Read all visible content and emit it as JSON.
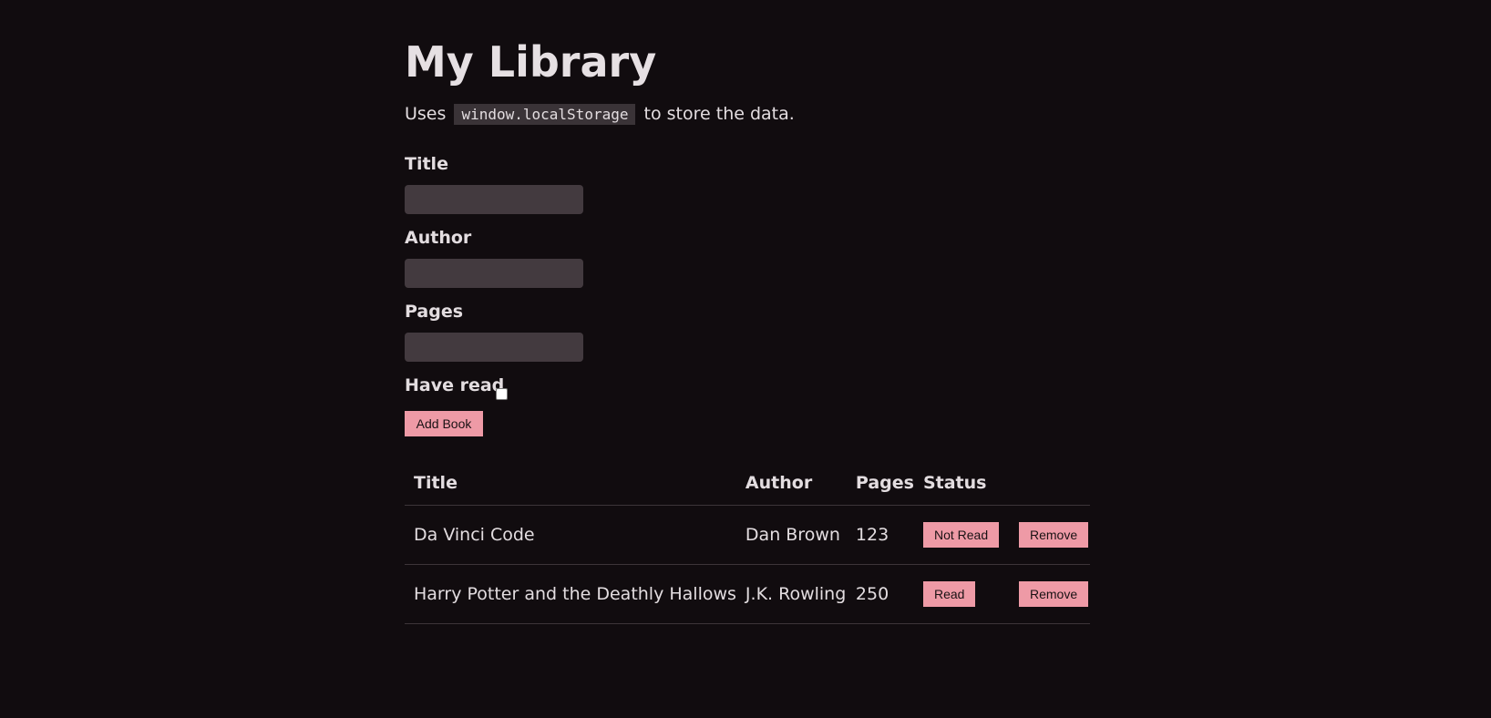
{
  "page": {
    "title": "My Library",
    "subtitle_before": "Uses",
    "subtitle_code": "window.localStorage",
    "subtitle_after": "to store the data."
  },
  "form": {
    "title_label": "Title",
    "title_value": "",
    "author_label": "Author",
    "author_value": "",
    "pages_label": "Pages",
    "pages_value": "",
    "have_read_label": "Have read",
    "have_read_checked": false,
    "add_button_label": "Add Book"
  },
  "table": {
    "headers": [
      "Title",
      "Author",
      "Pages",
      "Status",
      ""
    ],
    "rows": [
      {
        "title": "Da Vinci Code",
        "author": "Dan Brown",
        "pages": "123",
        "status": "Not Read",
        "action": "Remove"
      },
      {
        "title": "Harry Potter and the Deathly Hallows",
        "author": "J.K. Rowling",
        "pages": "250",
        "status": "Read",
        "action": "Remove"
      }
    ]
  },
  "colors": {
    "background": "#110c0f",
    "text": "#e3dde0",
    "input_bg": "#433a3f",
    "button_bg": "#ee9aa6",
    "button_text": "#1a1214",
    "divider": "#3d3539"
  }
}
